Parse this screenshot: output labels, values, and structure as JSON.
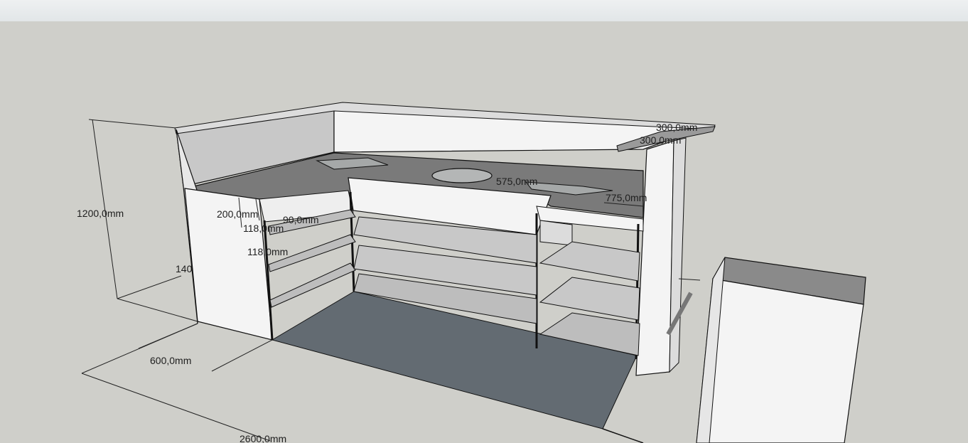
{
  "toolbar": {},
  "dimensions": {
    "height_total": "1200,0mm",
    "depth": "600,0mm",
    "length": "2600,0mm",
    "partial_140": "140",
    "shelf_200": "200,0mm",
    "shelf_90": "90,0mm",
    "shelf_118_a": "118,0mm",
    "shelf_118_b": "118,0mm",
    "top_300_a": "300,0mm",
    "top_300_b": "300,0mm",
    "width_575": "575,0mm",
    "width_775": "775,0mm"
  },
  "colors": {
    "background": "#cfcfca",
    "floor_shadow": "#636b72",
    "panel_white": "#f4f4f4",
    "panel_grey": "#c8c8c8",
    "countertop": "#7a7a7a"
  }
}
